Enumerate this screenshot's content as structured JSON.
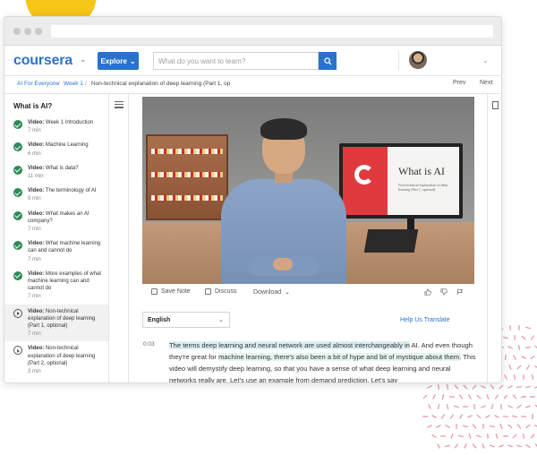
{
  "brand": {
    "logo": "coursera",
    "accent": "#2a73cc",
    "complete_color": "#2e8b57"
  },
  "header": {
    "explore_label": "Explore",
    "explore_icon": "chevron-down-icon",
    "search_placeholder": "What do you want to learn?",
    "search_icon": "search-icon",
    "user_menu_icon": "chevron-down-icon"
  },
  "breadcrumb": {
    "items": [
      "AI For Everyone",
      "Week 1",
      "Non-technical explanation of deep learning (Part 1, op"
    ],
    "separator": "/",
    "prev_label": "Prev",
    "next_label": "Next"
  },
  "sidebar": {
    "title": "What is AI?",
    "items": [
      {
        "type": "Video:",
        "title": "Week 1 Introduction",
        "duration": "7 min",
        "status": "completed"
      },
      {
        "type": "Video:",
        "title": "Machine Learning",
        "duration": "6 min",
        "status": "completed"
      },
      {
        "type": "Video:",
        "title": "What is data?",
        "duration": "11 min",
        "status": "completed"
      },
      {
        "type": "Video:",
        "title": "The terminology of AI",
        "duration": "9 min",
        "status": "completed"
      },
      {
        "type": "Video:",
        "title": "What makes an AI company?",
        "duration": "7 min",
        "status": "completed"
      },
      {
        "type": "Video:",
        "title": "What machine learning can and cannot do",
        "duration": "7 min",
        "status": "completed"
      },
      {
        "type": "Video:",
        "title": "More examples of what machine learning can and cannot do",
        "duration": "7 min",
        "status": "completed"
      },
      {
        "type": "Video:",
        "title": "Non-technical explanation of deep learning (Part 1, optional)",
        "duration": "7 min",
        "status": "current"
      },
      {
        "type": "Video:",
        "title": "Non-technical explanation of deep learning (Part 2, optional)",
        "duration": "3 min",
        "status": "not-started"
      }
    ]
  },
  "video": {
    "slide_title": "What is AI",
    "slide_subtitle": "Non-technical explanation of deep learning (Part 1, optional)"
  },
  "video_toolbar": {
    "save_note": "Save Note",
    "discuss": "Discuss",
    "download": "Download"
  },
  "transcript": {
    "language": "English",
    "help_translate": "Help Us Translate",
    "timestamp": "0:03",
    "segments": [
      {
        "text": "The terms deep learning and neural network are used almost interchangeably in",
        "highlight": "hl1"
      },
      {
        "text": " AI. And even though they're great for ",
        "highlight": ""
      },
      {
        "text": "machine learning, there's also been a bit of hype and bit of mystique about them.",
        "highlight": "hl2"
      },
      {
        "text": " This video will demystify deep learning, so that you have a sense of what deep learning and neural networks really are. Let's use an example from demand prediction. Let's say",
        "highlight": ""
      }
    ]
  }
}
